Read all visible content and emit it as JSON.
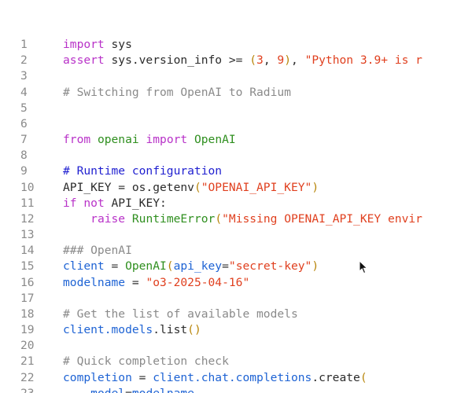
{
  "editor": {
    "lines": [
      {
        "n": "1",
        "tokens": [
          [
            "kw",
            "import"
          ],
          [
            "plain",
            " sys"
          ]
        ]
      },
      {
        "n": "2",
        "tokens": [
          [
            "kw",
            "assert"
          ],
          [
            "plain",
            " sys.version_info >= "
          ],
          [
            "paren",
            "("
          ],
          [
            "num",
            "3"
          ],
          [
            "plain",
            ", "
          ],
          [
            "num",
            "9"
          ],
          [
            "paren",
            ")"
          ],
          [
            "plain",
            ", "
          ],
          [
            "str",
            "\"Python 3.9+ is r"
          ]
        ]
      },
      {
        "n": "3",
        "tokens": []
      },
      {
        "n": "4",
        "tokens": [
          [
            "comment",
            "# Switching from OpenAI to Radium"
          ]
        ]
      },
      {
        "n": "5",
        "tokens": []
      },
      {
        "n": "6",
        "tokens": []
      },
      {
        "n": "7",
        "tokens": [
          [
            "kw",
            "from"
          ],
          [
            "plain",
            " "
          ],
          [
            "mod",
            "openai"
          ],
          [
            "plain",
            " "
          ],
          [
            "kw",
            "import"
          ],
          [
            "plain",
            " "
          ],
          [
            "mod",
            "OpenAI"
          ]
        ]
      },
      {
        "n": "8",
        "tokens": []
      },
      {
        "n": "9",
        "tokens": [
          [
            "doc",
            "# Runtime configuration"
          ]
        ]
      },
      {
        "n": "10",
        "tokens": [
          [
            "plain",
            "API_KEY = os.getenv"
          ],
          [
            "paren",
            "("
          ],
          [
            "str",
            "\"OPENAI_API_KEY\""
          ],
          [
            "paren",
            ")"
          ]
        ]
      },
      {
        "n": "11",
        "tokens": [
          [
            "kw",
            "if"
          ],
          [
            "plain",
            " "
          ],
          [
            "kw",
            "not"
          ],
          [
            "plain",
            " API_KEY:"
          ]
        ]
      },
      {
        "n": "12",
        "tokens": [
          [
            "plain",
            "    "
          ],
          [
            "kw",
            "raise"
          ],
          [
            "plain",
            " "
          ],
          [
            "cls",
            "RuntimeError"
          ],
          [
            "paren",
            "("
          ],
          [
            "str",
            "\"Missing OPENAI_API_KEY envir"
          ]
        ]
      },
      {
        "n": "13",
        "tokens": []
      },
      {
        "n": "14",
        "tokens": [
          [
            "comment",
            "### OpenAI"
          ]
        ]
      },
      {
        "n": "15",
        "tokens": [
          [
            "var",
            "client"
          ],
          [
            "plain",
            " = "
          ],
          [
            "cls",
            "OpenAI"
          ],
          [
            "paren",
            "("
          ],
          [
            "var",
            "api_key"
          ],
          [
            "plain",
            "="
          ],
          [
            "str",
            "\"secret-key\""
          ],
          [
            "paren",
            ")"
          ]
        ]
      },
      {
        "n": "16",
        "tokens": [
          [
            "var",
            "modelname"
          ],
          [
            "plain",
            " = "
          ],
          [
            "str",
            "\"o3-2025-04-16\""
          ]
        ]
      },
      {
        "n": "17",
        "tokens": []
      },
      {
        "n": "18",
        "tokens": [
          [
            "comment",
            "# Get the list of available models"
          ]
        ]
      },
      {
        "n": "19",
        "tokens": [
          [
            "var",
            "client.models"
          ],
          [
            "plain",
            ".list"
          ],
          [
            "paren",
            "()"
          ]
        ]
      },
      {
        "n": "20",
        "tokens": []
      },
      {
        "n": "21",
        "tokens": [
          [
            "comment",
            "# Quick completion check"
          ]
        ]
      },
      {
        "n": "22",
        "tokens": [
          [
            "var",
            "completion"
          ],
          [
            "plain",
            " = "
          ],
          [
            "var",
            "client.chat.completions"
          ],
          [
            "plain",
            ".create"
          ],
          [
            "paren",
            "("
          ]
        ]
      },
      {
        "n": "23",
        "tokens": [
          [
            "plain",
            "    "
          ],
          [
            "var",
            "model"
          ],
          [
            "plain",
            "="
          ],
          [
            "var",
            "modelname"
          ],
          [
            "plain",
            ","
          ]
        ]
      }
    ]
  },
  "icons": {
    "cursor": "mouse-pointer-icon"
  }
}
